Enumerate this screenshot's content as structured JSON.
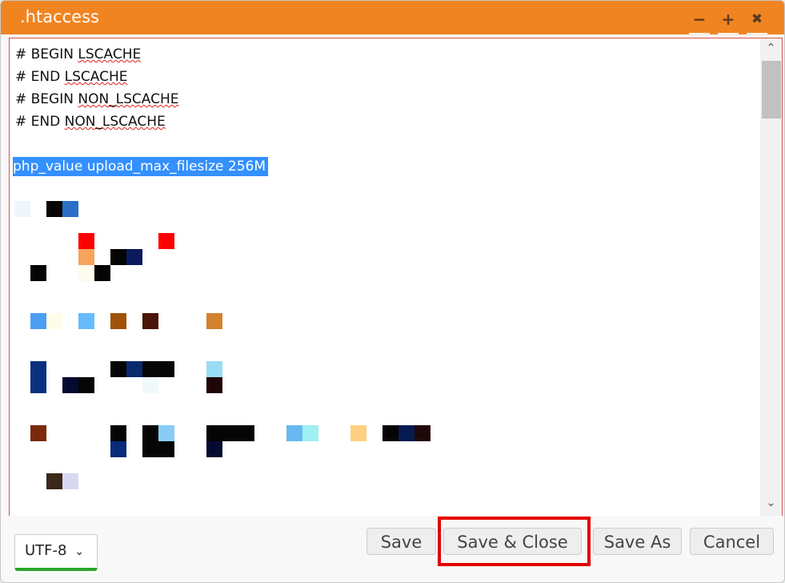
{
  "window": {
    "title": ".htaccess",
    "controls": {
      "minimize": "−",
      "maximize": "+",
      "close": "✖"
    },
    "accent": "#f08421"
  },
  "editor": {
    "lines": [
      "# BEGIN LSCACHE",
      "# END LSCACHE",
      "# BEGIN NON_LSCACHE",
      "# END NON_LSCACHE"
    ],
    "selected_line": "php_value upload_max_filesize 256M"
  },
  "footer": {
    "encoding": "UTF-8",
    "buttons": {
      "save": "Save",
      "save_close": "Save & Close",
      "save_as": "Save As",
      "cancel": "Cancel"
    },
    "highlight_color": "#e50000"
  }
}
